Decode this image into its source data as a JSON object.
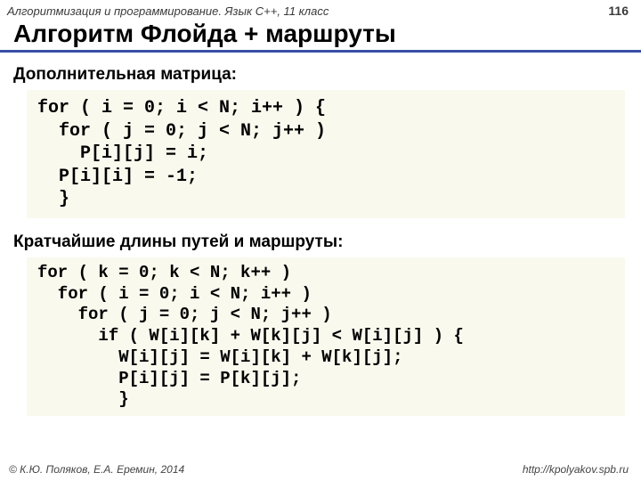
{
  "header": {
    "course": "Алгоритмизация и программирование. Язык C++, 11 класс",
    "page": "116"
  },
  "title": "Алгоритм Флойда + маршруты",
  "section1": {
    "label": "Дополнительная матрица:",
    "code": "for ( i = 0; i < N; i++ ) {\n  for ( j = 0; j < N; j++ )\n    P[i][j] = i;\n  P[i][i] = -1;\n  }"
  },
  "section2": {
    "label": "Кратчайшие длины путей и маршруты:",
    "code": "for ( k = 0; k < N; k++ )\n  for ( i = 0; i < N; i++ )\n    for ( j = 0; j < N; j++ )\n      if ( W[i][k] + W[k][j] < W[i][j] ) {\n        W[i][j] = W[i][k] + W[k][j];\n        P[i][j] = P[k][j];\n        }"
  },
  "footer": {
    "copyright": "© К.Ю. Поляков, Е.А. Еремин, 2014",
    "url": "http://kpolyakov.spb.ru"
  }
}
